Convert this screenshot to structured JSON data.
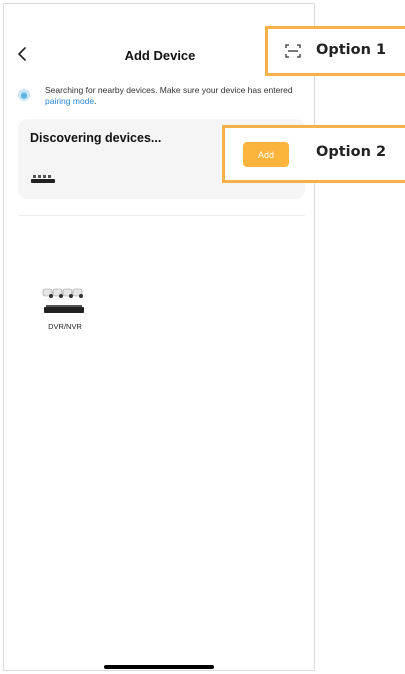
{
  "header": {
    "title": "Add Device",
    "back_icon": "chevron-left-icon",
    "scan_icon": "scan-icon"
  },
  "notice": {
    "text_before_link": "Searching for nearby devices. Make sure your device has entered ",
    "link_text": "pairing mode",
    "text_after_link": "."
  },
  "discovery": {
    "title": "Discovering devices...",
    "add_label": "Add",
    "device_icon": "dvr-icon"
  },
  "categories": [
    {
      "label": "DVR/NVR",
      "icon": "dvr-camera-kit-icon"
    }
  ],
  "annotations": {
    "option1": "Option 1",
    "option2": "Option 2"
  },
  "colors": {
    "accent": "#fbb53d",
    "callout_border": "#f5b14a",
    "link": "#2a86d7",
    "card_bg": "#f5f5f5"
  }
}
